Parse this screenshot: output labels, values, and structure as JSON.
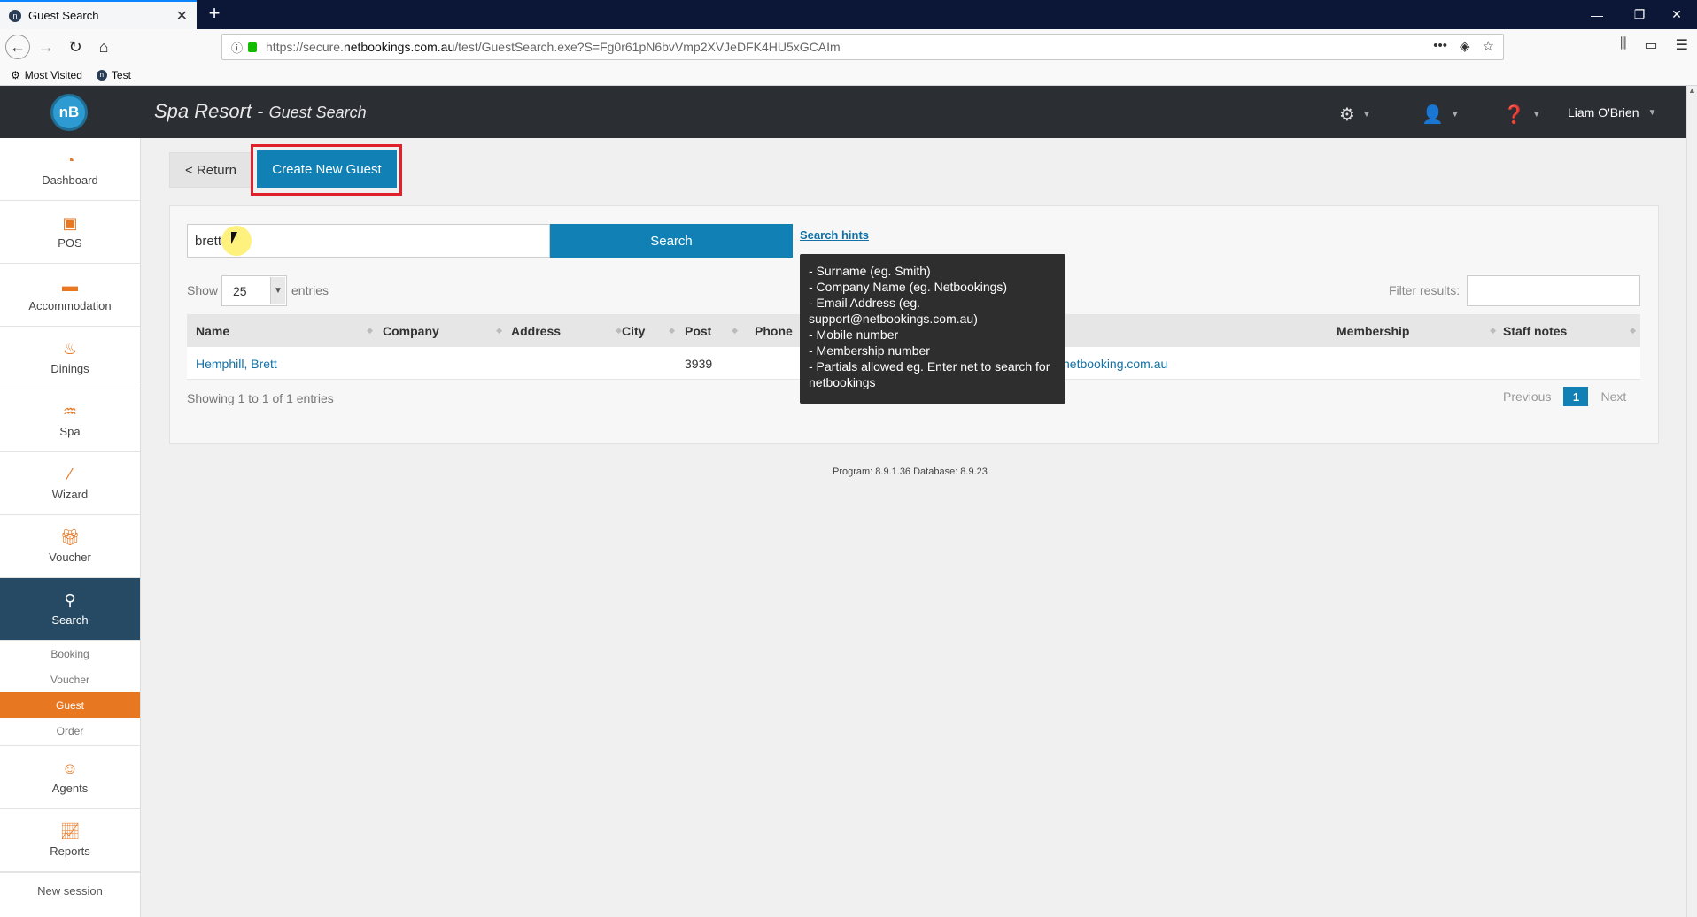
{
  "browser": {
    "tab_title": "Guest Search",
    "tab_favicon": "n",
    "url_prefix": "https://secure.",
    "url_domain": "netbookings.com.au",
    "url_path": "/test/GuestSearch.exe?S=Fg0r61pN6bvVmp2XVJeDFK4HU5xGCAIm",
    "bookmarks": [
      {
        "label": "Most Visited",
        "icon": "gear-icon"
      },
      {
        "label": "Test",
        "icon": "n"
      }
    ]
  },
  "header": {
    "logo_text": "nB",
    "app_name": "Spa Resort",
    "separator": " - ",
    "page_name": "Guest Search",
    "user_name": "Liam O'Brien"
  },
  "sidebar": {
    "items": [
      {
        "label": "Dashboard",
        "icon": "gauge-icon"
      },
      {
        "label": "POS",
        "icon": "pos-icon"
      },
      {
        "label": "Accommodation",
        "icon": "bed-icon"
      },
      {
        "label": "Dinings",
        "icon": "dining-icon"
      },
      {
        "label": "Spa",
        "icon": "spa-icon"
      },
      {
        "label": "Wizard",
        "icon": "wand-icon"
      },
      {
        "label": "Voucher",
        "icon": "gift-icon"
      },
      {
        "label": "Search",
        "icon": "search-icon"
      }
    ],
    "sub_items": [
      "Booking",
      "Voucher",
      "Guest",
      "Order"
    ],
    "bottom_items": [
      {
        "label": "Agents",
        "icon": "agent-icon"
      },
      {
        "label": "Reports",
        "icon": "chart-icon"
      }
    ],
    "new_session": "New session"
  },
  "actions": {
    "return_label": "< Return",
    "create_label": "Create New Guest"
  },
  "search": {
    "value": "brett",
    "button_label": "Search",
    "hints_label": "Search hints"
  },
  "tooltip": {
    "lines": [
      "- Surname (eg. Smith)",
      "- Company Name (eg. Netbookings)",
      "- Email Address (eg. support@netbookings.com.au)",
      "- Mobile number",
      "- Membership number",
      "- Partials allowed eg. Enter net to search for netbookings"
    ]
  },
  "table": {
    "show_label": "Show",
    "page_size": "25",
    "entries_label": "entries",
    "filter_label": "Filter results:",
    "columns": [
      "Name",
      "Company",
      "Address",
      "City",
      "Post",
      "Phone",
      "Membership",
      "Staff notes"
    ],
    "rows": [
      {
        "name": "Hemphill, Brett",
        "post": "3939",
        "email_fragment": "netbooking.com.au"
      }
    ],
    "showing_text": "Showing 1 to 1 of 1 entries",
    "pager": {
      "previous": "Previous",
      "current": "1",
      "next": "Next"
    }
  },
  "footer": {
    "version": "Program: 8.9.1.36 Database: 8.9.23"
  },
  "colors": {
    "accent_blue": "#1181b5",
    "accent_orange": "#e87722",
    "highlight_red": "#e0202a",
    "header_dark": "#2b2e33",
    "sidebar_active": "#264a63"
  }
}
